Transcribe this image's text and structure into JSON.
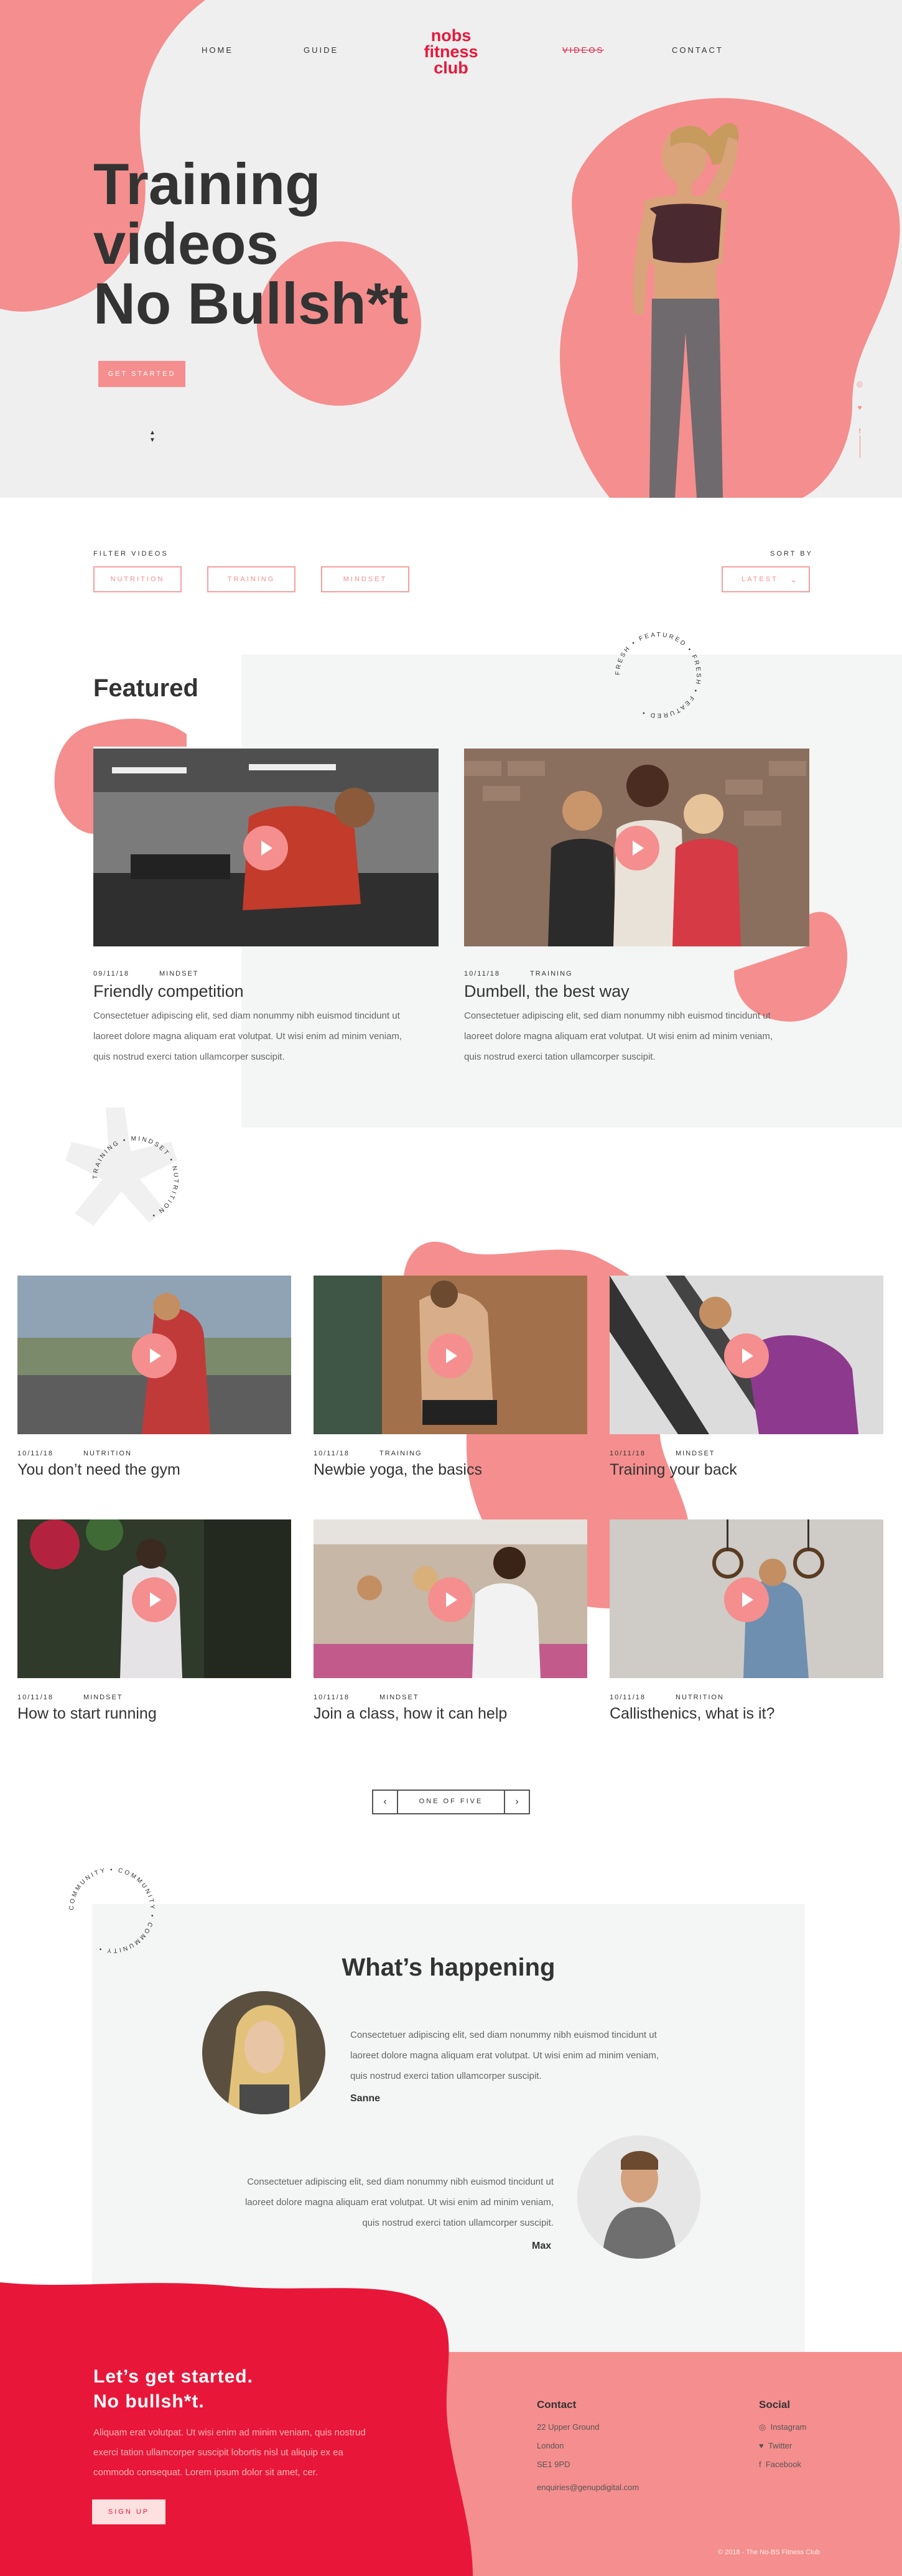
{
  "nav": {
    "logo": [
      "nobs",
      "fitness",
      "club"
    ],
    "links": [
      {
        "label": "HOME"
      },
      {
        "label": "GUIDE"
      },
      {
        "label": "VIDEOS"
      },
      {
        "label": "CONTACT"
      }
    ]
  },
  "hero": {
    "title_lines": [
      "Training",
      "videos",
      "No Bullsh*t"
    ],
    "cta": "GET STARTED",
    "scroll_icon": "chevron-down-icon",
    "social_icons": [
      "instagram-icon",
      "twitter-icon",
      "facebook-icon"
    ]
  },
  "filters": {
    "label": "FILTER VIDEOS",
    "options": [
      "NUTRITION",
      "TRAINING",
      "MINDSET"
    ],
    "sort_label": "SORT BY",
    "sort_value": "LATEST"
  },
  "featured": {
    "title": "Featured",
    "badge_text": "FRESH • FEATURED • FRESH • FEATURED •",
    "cards": [
      {
        "date": "09/11/18",
        "category": "MINDSET",
        "title": "Friendly competition",
        "description": [
          "Consectetuer adipiscing elit, sed diam nonummy nibh euismod tincidunt ut",
          "laoreet dolore magna aliquam erat volutpat. Ut wisi enim ad minim veniam,",
          "quis nostrud exerci tation ullamcorper suscipit."
        ]
      },
      {
        "date": "10/11/18",
        "category": "TRAINING",
        "title": "Dumbell, the best way",
        "description": [
          "Consectetuer adipiscing elit, sed diam nonummy nibh euismod tincidunt ut",
          "laoreet dolore magna aliquam erat volutpat. Ut wisi enim ad minim veniam,",
          "quis nostrud exerci tation ullamcorper suscipit."
        ]
      }
    ]
  },
  "grid": {
    "badge_text": "TRAINING • MINDSET • NUTRITION •",
    "videos": [
      {
        "date": "10/11/18",
        "category": "NUTRITION",
        "title": "You don’t need the gym"
      },
      {
        "date": "10/11/18",
        "category": "TRAINING",
        "title": "Newbie yoga, the basics"
      },
      {
        "date": "10/11/18",
        "category": "MINDSET",
        "title": "Training your back"
      },
      {
        "date": "10/11/18",
        "category": "MINDSET",
        "title": "How to start running"
      },
      {
        "date": "10/11/18",
        "category": "MINDSET",
        "title": "Join a class, how it can help"
      },
      {
        "date": "10/11/18",
        "category": "NUTRITION",
        "title": "Callisthenics, what is it?"
      }
    ]
  },
  "pagination": {
    "label": "ONE OF FIVE"
  },
  "happening": {
    "badge_text": "COMMUNITY • COMMUNITY • COMMUNITY •",
    "title": "What’s happening",
    "posts": [
      {
        "text": [
          "Consectetuer adipiscing elit, sed diam nonummy nibh euismod tincidunt ut",
          "laoreet dolore magna aliquam erat volutpat. Ut wisi enim ad minim veniam,",
          "quis nostrud exerci tation ullamcorper suscipit."
        ],
        "name": "Sanne"
      },
      {
        "text": [
          "Consectetuer adipiscing elit, sed diam nonummy nibh euismod tincidunt ut",
          "laoreet dolore magna aliquam erat volutpat. Ut wisi enim ad minim veniam,",
          "quis nostrud exerci tation ullamcorper suscipit."
        ],
        "name": "Max"
      }
    ]
  },
  "footer": {
    "headline": [
      "Let’s get started.",
      "No bullsh*t."
    ],
    "body": [
      "Aliquam erat volutpat. Ut wisi enim ad minim veniam, quis nostrud",
      "exerci tation ullamcorper suscipit lobortis nisl ut aliquip ex ea",
      "commodo consequat. Lorem ipsum dolor sit amet, cer."
    ],
    "signup": "SIGN UP",
    "contact": {
      "title": "Contact",
      "lines": [
        "22 Upper Ground",
        "London",
        "SE1 9PD",
        "enquiries@genupdigital.com"
      ]
    },
    "social": {
      "title": "Social",
      "items": [
        {
          "icon": "instagram-icon",
          "label": "Instagram"
        },
        {
          "icon": "twitter-icon",
          "label": "Twitter"
        },
        {
          "icon": "facebook-icon",
          "label": "Facebook"
        }
      ]
    },
    "copyright": "© 2018 - The No-BS Fitness Club"
  },
  "colors": {
    "accent": "#f58e8e",
    "brand_red": "#e8173a",
    "panel": "#f4f5f5"
  }
}
